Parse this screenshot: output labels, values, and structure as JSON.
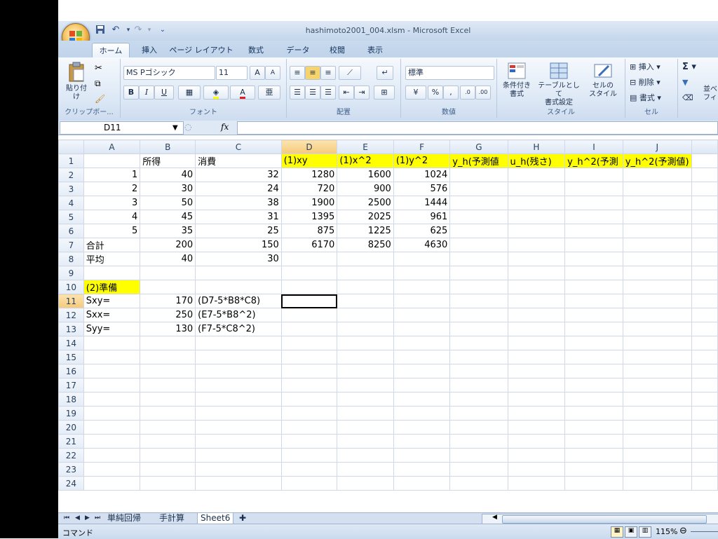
{
  "window": {
    "title": "hashimoto2001_004.xlsm - Microsoft Excel"
  },
  "ribbon_tabs": [
    "ホーム",
    "挿入",
    "ページ レイアウト",
    "数式",
    "データ",
    "校閲",
    "表示"
  ],
  "clipboard": {
    "paste_label": "貼り付け",
    "group": "クリップボー..."
  },
  "font": {
    "name": "MS Pゴシック",
    "size": "11",
    "bold": "B",
    "italic": "I",
    "underline": "U",
    "group": "フォント"
  },
  "alignment": {
    "group": "配置"
  },
  "number": {
    "format": "標準",
    "percent": "%",
    "comma": ",",
    "group": "数値"
  },
  "styles": {
    "conditional": "条件付き\n書式",
    "table": "テーブルとして\n書式設定",
    "cell_style": "セルの\nスタイル",
    "group": "スタイル"
  },
  "cells_group": {
    "insert": "挿入",
    "delete": "削除",
    "format": "書式",
    "group": "セル"
  },
  "editing": {
    "sigma": "Σ",
    "sort": "並べ",
    "filter": "フィ"
  },
  "formula_bar": {
    "name_box": "D11",
    "fx": "fx",
    "value": ""
  },
  "columns": [
    "A",
    "B",
    "C",
    "D",
    "E",
    "F",
    "G",
    "H",
    "I",
    "J"
  ],
  "rows": [
    [
      "",
      "所得",
      "消費",
      "(1)xy",
      "(1)x^2",
      "(1)y^2",
      "y_h(予測値",
      "u_h(残さ)",
      "y_h^2(予測",
      "y_h^2(予測値)"
    ],
    [
      "1",
      "40",
      "32",
      "1280",
      "1600",
      "1024",
      "",
      "",
      "",
      ""
    ],
    [
      "2",
      "30",
      "24",
      "720",
      "900",
      "576",
      "",
      "",
      "",
      ""
    ],
    [
      "3",
      "50",
      "38",
      "1900",
      "2500",
      "1444",
      "",
      "",
      "",
      ""
    ],
    [
      "4",
      "45",
      "31",
      "1395",
      "2025",
      "961",
      "",
      "",
      "",
      ""
    ],
    [
      "5",
      "35",
      "25",
      "875",
      "1225",
      "625",
      "",
      "",
      "",
      ""
    ],
    [
      "合計",
      "200",
      "150",
      "6170",
      "8250",
      "4630",
      "",
      "",
      "",
      ""
    ],
    [
      "平均",
      "40",
      "30",
      "",
      "",
      "",
      "",
      "",
      "",
      ""
    ],
    [
      "",
      "",
      "",
      "",
      "",
      "",
      "",
      "",
      "",
      ""
    ],
    [
      "(2)準備",
      "",
      "",
      "",
      "",
      "",
      "",
      "",
      "",
      ""
    ],
    [
      "Sxy=",
      "170",
      "(D7-5*B8*C8)",
      "",
      "",
      "",
      "",
      "",
      "",
      ""
    ],
    [
      "Sxx=",
      "250",
      "(E7-5*B8^2)",
      "",
      "",
      "",
      "",
      "",
      "",
      ""
    ],
    [
      "Syy=",
      "130",
      "(F7-5*C8^2)",
      "",
      "",
      "",
      "",
      "",
      "",
      ""
    ]
  ],
  "row_count": 24,
  "sheet_tabs": [
    "単純回帰",
    "手計算",
    "Sheet6"
  ],
  "status": {
    "mode": "コマンド",
    "zoom": "115%"
  },
  "colors": {
    "highlight": "#ffff00",
    "ribbon": "#dbe7f5"
  }
}
